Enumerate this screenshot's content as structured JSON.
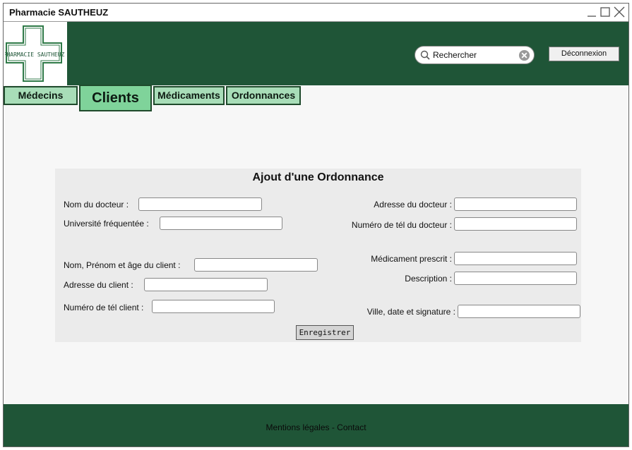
{
  "window": {
    "title": "Pharmacie SAUTHEUZ"
  },
  "header": {
    "logo_text": "PHARMACIE SAUTHEUZ",
    "search": {
      "value": "Rechercher"
    },
    "logout_label": "Déconnexion"
  },
  "tabs": [
    {
      "label": "Médecins"
    },
    {
      "label": "Clients"
    },
    {
      "label": "Médicaments"
    },
    {
      "label": "Ordonnances"
    }
  ],
  "form": {
    "title": "Ajout d'une Ordonnance",
    "doctor_name_label": "Nom du docteur :",
    "university_label": "Université fréquentée :",
    "client_name_label": "Nom, Prénom et âge du client :",
    "client_address_label": "Adresse du client :",
    "client_phone_label": "Numéro de tél client :",
    "doctor_address_label": "Adresse du docteur :",
    "doctor_phone_label": "Numéro de tél du docteur :",
    "medicine_label": "Médicament prescrit :",
    "description_label": "Description :",
    "signature_label": "Ville, date et signature :",
    "save_label": "Enregistrer"
  },
  "footer": {
    "text": "Mentions légales - Contact"
  },
  "colors": {
    "header_bg": "#1f5537",
    "tab_bg": "#a8ddb8",
    "active_tab_bg": "#7fd39a"
  }
}
